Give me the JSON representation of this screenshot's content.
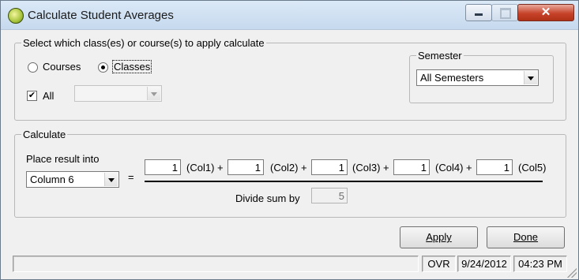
{
  "window": {
    "title": "Calculate Student Averages"
  },
  "selection": {
    "legend": "Select which class(es) or course(s) to apply calculate",
    "courses_label": "Courses",
    "classes_label": "Classes",
    "courses_selected": false,
    "classes_selected": true,
    "all_label": "All",
    "all_checked": true,
    "class_combo_value": ""
  },
  "semester": {
    "legend": "Semester",
    "value": "All Semesters"
  },
  "calculate": {
    "legend": "Calculate",
    "place_result_label": "Place result into",
    "place_result_value": "Column 6",
    "equals": "=",
    "weights": [
      {
        "value": "1",
        "label": "(Col1) +"
      },
      {
        "value": "1",
        "label": "(Col2) +"
      },
      {
        "value": "1",
        "label": "(Col3) +"
      },
      {
        "value": "1",
        "label": "(Col4) +"
      },
      {
        "value": "1",
        "label": "(Col5)"
      }
    ],
    "divide_label": "Divide sum by",
    "divide_value": "5"
  },
  "buttons": {
    "apply": "Apply",
    "done": "Done"
  },
  "statusbar": {
    "mode": "OVR",
    "date": "9/24/2012",
    "time": "04:23 PM"
  }
}
